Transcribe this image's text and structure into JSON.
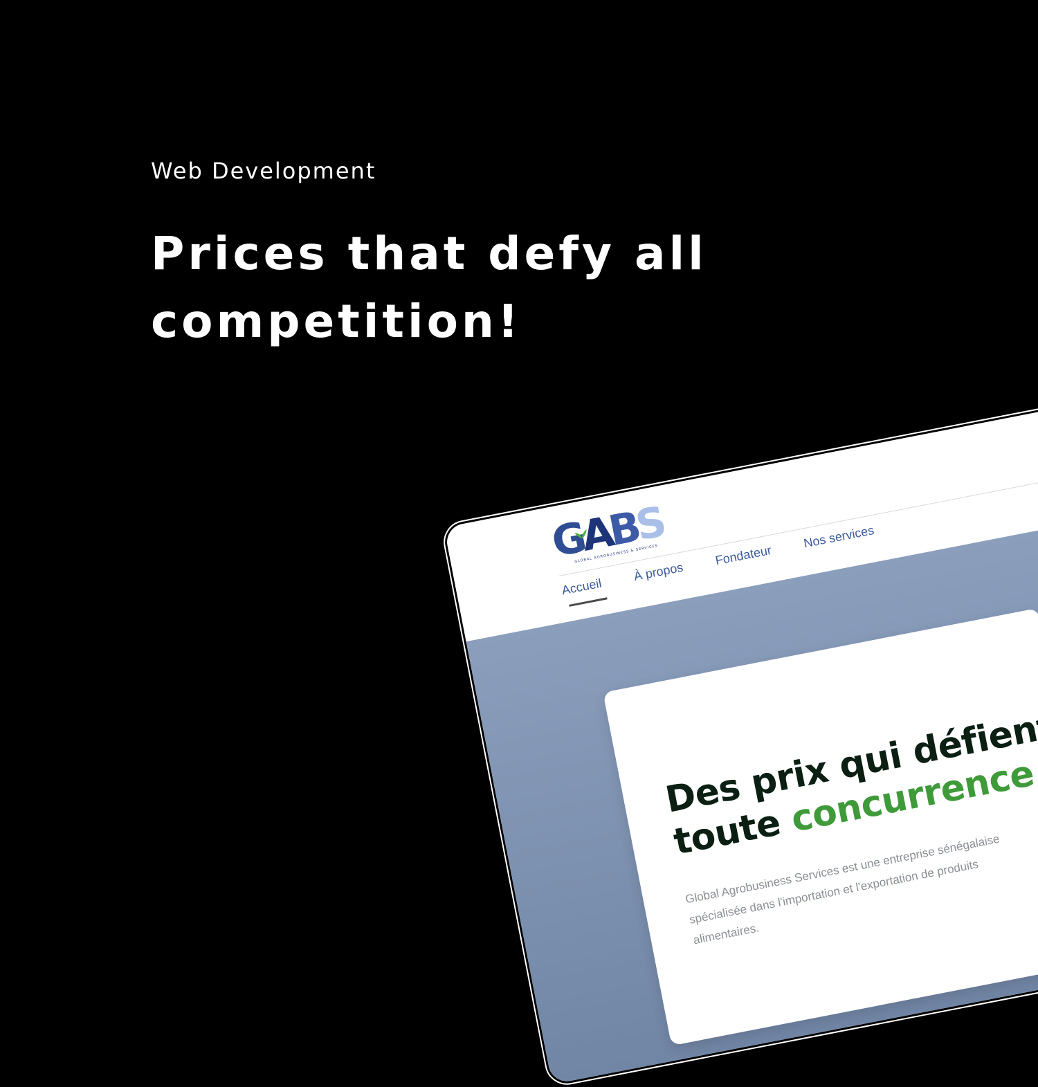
{
  "intro": {
    "eyebrow": "Web Development",
    "headline": "Prices that defy all competition!"
  },
  "site": {
    "logo": {
      "letters": [
        "G",
        "A",
        "B",
        "S"
      ],
      "tagline": "GLOBAL AGROBUSINESS & SERVICES",
      "colors": [
        "#2f4d93",
        "#1d3478",
        "#3d5aa6",
        "#a9bfe8"
      ],
      "leaf_color": "#4fae3f"
    },
    "nav": {
      "items": [
        "Accueil",
        "À propos",
        "Fondateur",
        "Nos services"
      ],
      "active": "Accueil"
    },
    "hero": {
      "title_line1": "Des prix qui défient",
      "title_word": "toute",
      "title_accent": "concurrence !",
      "body": "Global Agrobusiness Services est une entreprise  sénégalaise spécialisée dans l'importation et l'exportation de produits alimentaires.",
      "accent_color": "#3f9a3a"
    }
  }
}
